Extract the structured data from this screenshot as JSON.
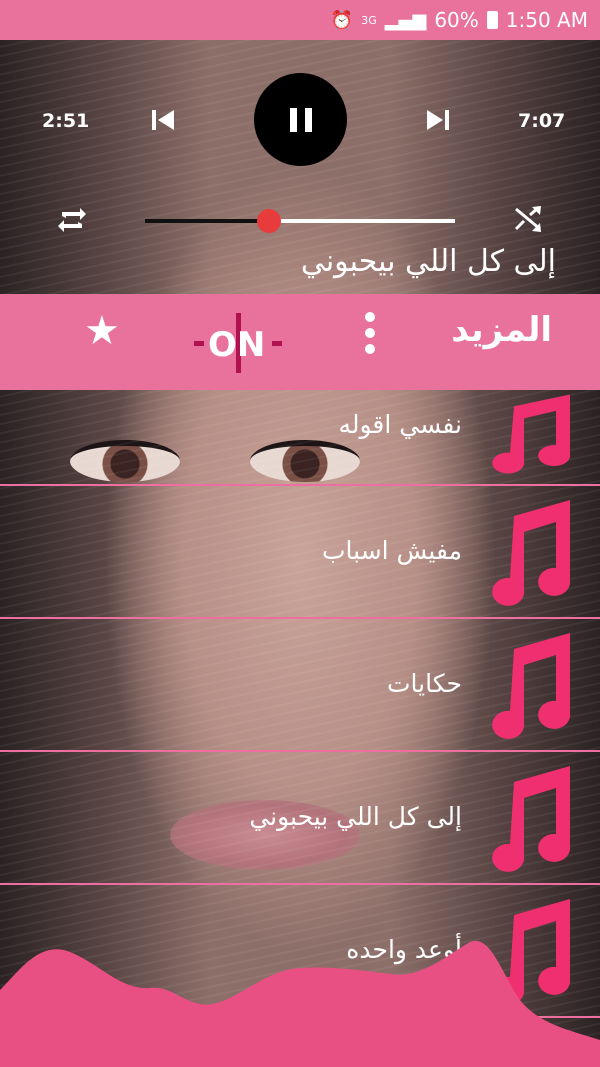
{
  "status_bar": {
    "battery": "60%",
    "time": "1:50 AM",
    "network": "3G"
  },
  "player": {
    "elapsed": "2:51",
    "duration": "7:07",
    "progress": 0.4,
    "now_playing": "إلى كل اللي بيحبوني",
    "state": "playing"
  },
  "toolbar": {
    "more_label": "المزيد",
    "logo_text": "ON"
  },
  "songs": [
    {
      "title": "نفسي اقوله"
    },
    {
      "title": "مفيش اسباب"
    },
    {
      "title": "حكايات"
    },
    {
      "title": "إلى كل اللي بيحبوني"
    },
    {
      "title": "أوعد واحده"
    }
  ],
  "colors": {
    "accent": "#e8729c",
    "note": "#ef2f6f",
    "seek_knob": "#e83b3b",
    "wave": "#e84f83"
  },
  "icons": {
    "prev": "skip-previous-icon",
    "next": "skip-next-icon",
    "pause": "pause-icon",
    "repeat": "repeat-icon",
    "shuffle": "shuffle-icon",
    "star": "star-icon",
    "menu": "kebab-menu-icon",
    "song": "music-note-icon"
  }
}
